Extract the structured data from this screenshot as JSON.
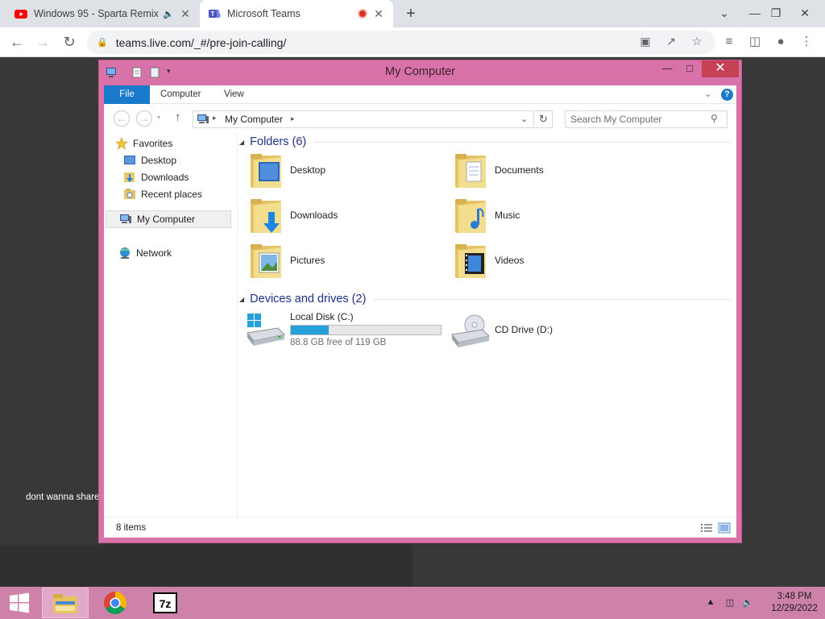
{
  "browser": {
    "tabs": [
      {
        "title": "Windows 95 - Sparta Remix",
        "favicon": "youtube-icon",
        "audio": "speaker-icon"
      },
      {
        "title": "Microsoft Teams",
        "favicon": "teams-icon",
        "recording": "record-icon"
      }
    ],
    "new_tab": "+",
    "url": "teams.live.com/_#/pre-join-calling/"
  },
  "page": {
    "caption": "dont wanna share"
  },
  "explorer": {
    "title": "My Computer",
    "ribbon_tabs": [
      "File",
      "Computer",
      "View"
    ],
    "address": "My Computer",
    "search_placeholder": "Search My Computer",
    "nav": {
      "favorites_label": "Favorites",
      "favorites": [
        "Desktop",
        "Downloads",
        "Recent places"
      ],
      "my_computer": "My Computer",
      "network": "Network"
    },
    "folders_header": "Folders (6)",
    "folders": [
      {
        "name": "Desktop",
        "icon": "desktop-folder-icon"
      },
      {
        "name": "Documents",
        "icon": "documents-folder-icon"
      },
      {
        "name": "Downloads",
        "icon": "downloads-folder-icon"
      },
      {
        "name": "Music",
        "icon": "music-folder-icon"
      },
      {
        "name": "Pictures",
        "icon": "pictures-folder-icon"
      },
      {
        "name": "Videos",
        "icon": "videos-folder-icon"
      }
    ],
    "drives_header": "Devices and drives (2)",
    "drives": [
      {
        "name": "Local Disk (C:)",
        "free_text": "88.8 GB free of 119 GB",
        "used_fraction": 0.254
      },
      {
        "name": "CD Drive (D:)"
      }
    ],
    "status": "8 items",
    "colors": {
      "frame": "#d972a8",
      "accent": "#1979ca",
      "drive_bar": "#26a0da"
    }
  },
  "taskbar": {
    "apps": [
      "file-explorer-icon",
      "chrome-icon",
      "7zip-icon"
    ],
    "time": "3:48 PM",
    "date": "12/29/2022"
  }
}
